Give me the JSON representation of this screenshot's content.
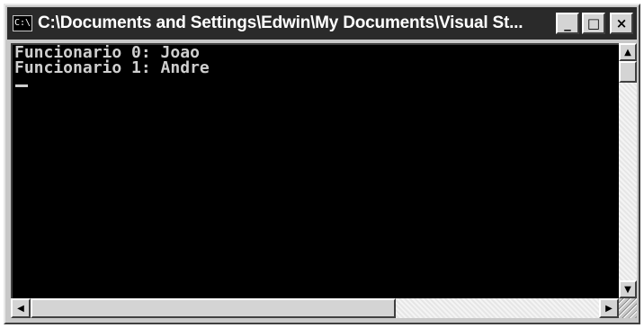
{
  "window": {
    "title": "C:\\Documents and Settings\\Edwin\\My Documents\\Visual St...",
    "icon": "cmd-icon",
    "buttons": {
      "minimize": "_",
      "maximize": "□",
      "close": "×"
    }
  },
  "console": {
    "lines": [
      "Funcionario 0: Joao",
      "Funcionario 1: Andre"
    ],
    "cursor": "_"
  },
  "scrollbars": {
    "up_arrow": "▲",
    "down_arrow": "▼",
    "left_arrow": "◀",
    "right_arrow": "▶"
  }
}
